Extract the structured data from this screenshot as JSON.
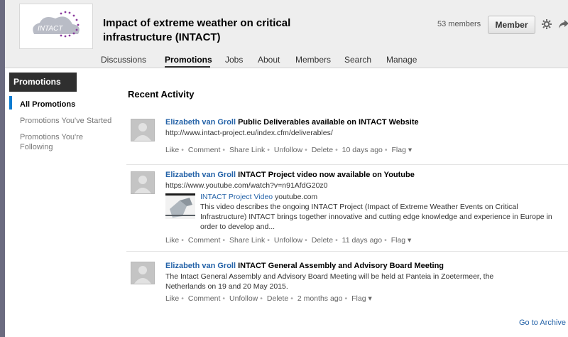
{
  "header": {
    "logo_text": "INTACT",
    "group_title": "Impact of extreme weather on critical infrastructure (INTACT)",
    "members_count": "53 members",
    "member_button": "Member"
  },
  "nav": {
    "tabs": [
      "Discussions",
      "Promotions",
      "Jobs",
      "About",
      "Members",
      "Search",
      "Manage"
    ],
    "active": "Promotions"
  },
  "sidebar": {
    "heading": "Promotions",
    "items": [
      {
        "label": "All Promotions"
      },
      {
        "label": "Promotions You've Started"
      },
      {
        "label": "Promotions You're Following"
      }
    ]
  },
  "main": {
    "section_title": "Recent Activity",
    "posts": [
      {
        "author": "Elizabeth van Groll",
        "headline": "Public Deliverables available on INTACT Website",
        "body": "http://www.intact-project.eu/index.cfm/deliverables/",
        "actions": [
          "Like",
          "Comment",
          "Share Link",
          "Unfollow",
          "Delete",
          "10 days ago",
          "Flag ▾"
        ]
      },
      {
        "author": "Elizabeth van Groll",
        "headline": "INTACT Project video now available on Youtube",
        "body": "https://www.youtube.com/watch?v=n91AfdG20z0",
        "preview_link": "INTACT Project Video",
        "preview_source": "youtube.com",
        "preview_desc": "This video describes the ongoing INTACT Project (Impact of Extreme Weather Events on Critical Infrastructure) INTACT brings together innovative and cutting edge knowledge and experience in Europe in order to develop and...",
        "actions": [
          "Like",
          "Comment",
          "Share Link",
          "Unfollow",
          "Delete",
          "11 days ago",
          "Flag ▾"
        ]
      },
      {
        "author": "Elizabeth van Groll",
        "headline": "INTACT General Assembly and Advisory Board Meeting",
        "body": "The Intact General Assembly and Advisory Board Meeting will be held at Panteia in Zoetermeer, the Netherlands on 19 and 20 May 2015.",
        "actions": [
          "Like",
          "Comment",
          "Unfollow",
          "Delete",
          "2 months ago",
          "Flag ▾"
        ]
      }
    ],
    "archive_link": "Go to Archive"
  },
  "colors": {
    "link": "#2563a8",
    "sidebar_heading_bg": "#2f2f2f",
    "active_marker": "#0a7bd0",
    "header_bg": "#eeeeee"
  }
}
